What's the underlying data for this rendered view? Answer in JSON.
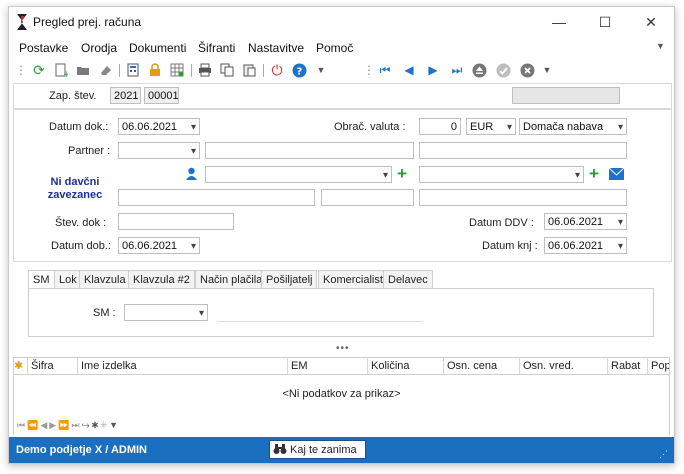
{
  "window": {
    "title": "Pregled prej. računa",
    "minimize_glyph": "—",
    "maximize_glyph": "☐",
    "close_glyph": "✕"
  },
  "menu": [
    "Postavke",
    "Orodja",
    "Dokumenti",
    "Šifranti",
    "Nastavitve",
    "Pomoč"
  ],
  "toolbar": {
    "icons": [
      "refresh-icon",
      "new-document-icon",
      "open-folder-icon",
      "eraser-icon",
      "calculator-icon",
      "lock-icon",
      "grid-icon",
      "printer-icon",
      "copy-icon",
      "paste-icon",
      "power-icon",
      "help-icon",
      "first-record-icon",
      "previous-record-icon",
      "next-record-icon",
      "last-record-icon",
      "eject-icon",
      "confirm-icon",
      "cancel-icon"
    ]
  },
  "header": {
    "zap_label": "Zap. štev.",
    "year": "2021",
    "number": "00001"
  },
  "form": {
    "datum_dok_label": "Datum dok.:",
    "datum_dok": "06.06.2021",
    "obrac_valuta_label": "Obrač. valuta :",
    "valuta_amount": "0",
    "currency": "EUR",
    "nabava_type": "Domača nabava",
    "partner_label": "Partner :",
    "partner_value": "",
    "ni_davcni": "Ni davčni zavezanec",
    "stev_dok_label": "Štev. dok :",
    "datum_ddv_label": "Datum DDV :",
    "datum_ddv": "06.06.2021",
    "datum_dob_label": "Datum dob.:",
    "datum_dob": "06.06.2021",
    "datum_knj_label": "Datum knj :",
    "datum_knj": "06.06.2021"
  },
  "tabs": [
    "SM",
    "Lok",
    "Klavzula",
    "Klavzula #2",
    "Način plačila",
    "Pošiljatelj",
    "Komercialist",
    "Delavec"
  ],
  "sm_panel": {
    "sm_label": "SM :"
  },
  "grid": {
    "columns": [
      "Šifra",
      "Ime izdelka",
      "EM",
      "Količina",
      "Osn. cena",
      "Osn. vred.",
      "Rabat",
      "Popu"
    ],
    "empty_text": "<Ni podatkov za prikaz>"
  },
  "status": {
    "company": "Demo podjetje X / ADMIN",
    "search_label": "Kaj te zanima"
  },
  "colors": {
    "status_bar": "#1a6fc0",
    "accent_green": "#2e9a3a",
    "accent_blue": "#1e73c8",
    "label_blue": "#1a2f9c"
  }
}
